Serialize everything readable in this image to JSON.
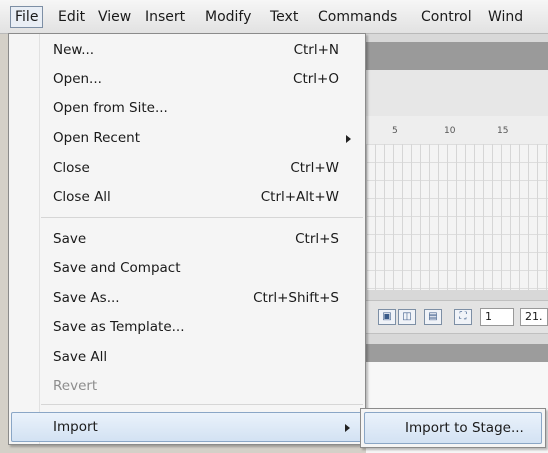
{
  "menubar": {
    "items": [
      "File",
      "Edit",
      "View",
      "Insert",
      "Modify",
      "Text",
      "Commands",
      "Control",
      "Wind"
    ]
  },
  "file_menu": {
    "groups": [
      [
        {
          "label": "New...",
          "shortcut": "Ctrl+N"
        },
        {
          "label": "Open...",
          "shortcut": "Ctrl+O"
        },
        {
          "label": "Open from Site...",
          "shortcut": ""
        },
        {
          "label": "Open Recent",
          "shortcut": "",
          "submenu": true
        },
        {
          "label": "Close",
          "shortcut": "Ctrl+W"
        },
        {
          "label": "Close All",
          "shortcut": "Ctrl+Alt+W"
        }
      ],
      [
        {
          "label": "Save",
          "shortcut": "Ctrl+S"
        },
        {
          "label": "Save and Compact",
          "shortcut": ""
        },
        {
          "label": "Save As...",
          "shortcut": "Ctrl+Shift+S"
        },
        {
          "label": "Save as Template...",
          "shortcut": ""
        },
        {
          "label": "Save All",
          "shortcut": ""
        },
        {
          "label": "Revert",
          "shortcut": "",
          "disabled": true
        }
      ],
      [
        {
          "label": "Import",
          "shortcut": "",
          "submenu": true,
          "highlighted": true
        }
      ]
    ]
  },
  "import_submenu": {
    "items": [
      {
        "label": "Import to Stage..."
      }
    ]
  },
  "timeline": {
    "ruler_ticks": [
      "5",
      "10",
      "15"
    ],
    "frame_field_value": "1",
    "frame_rate_value": "21."
  },
  "colors": {
    "highlight": "#d3e2f3",
    "menu_bg": "#f5f5f5",
    "disabled_text": "#8d8d8d"
  }
}
